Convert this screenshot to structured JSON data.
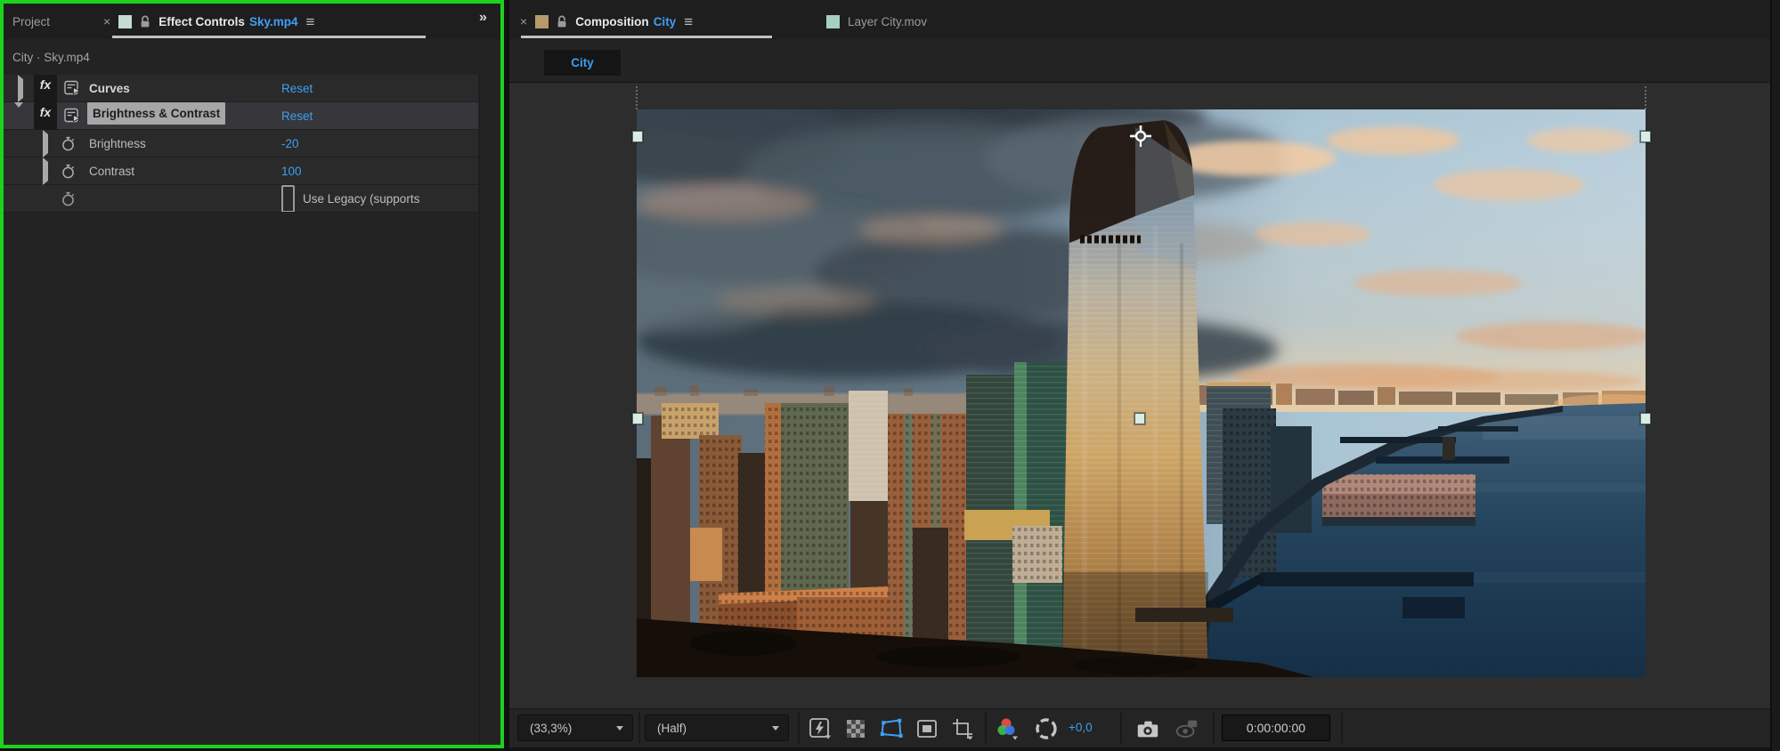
{
  "colors": {
    "accent_blue": "#3f9ff2",
    "highlight_green": "#1cd21c",
    "effect_tab_square": "#c3dbd0",
    "composition_tab_square": "#b69a6c",
    "layer_tab_square": "#a5cfc3",
    "panel_bg": "#232323",
    "viewer_bg": "#2d2d2d"
  },
  "effect_controls": {
    "tab_project": "Project",
    "close": "×",
    "title": "Effect Controls",
    "target": "Sky.mp4",
    "menu": "≡",
    "overflow": "»",
    "source": "City · Sky.mp4",
    "rows": [
      {
        "name": "Curves",
        "value": "Reset"
      },
      {
        "name": "Brightness & Contrast",
        "value": "Reset"
      },
      {
        "name": "Brightness",
        "value": "-20"
      },
      {
        "name": "Contrast",
        "value": "100"
      },
      {
        "name": "Use Legacy (supports",
        "value": ""
      }
    ]
  },
  "composition": {
    "close": "×",
    "title": "Composition",
    "target": "City",
    "menu": "≡",
    "tab_layer": "Layer City.mov",
    "subtab": "City",
    "toolbar": {
      "zoom": "(33,3%)",
      "resolution": "(Half)",
      "exposure": "+0,0",
      "timecode": "0:00:00:00"
    }
  }
}
